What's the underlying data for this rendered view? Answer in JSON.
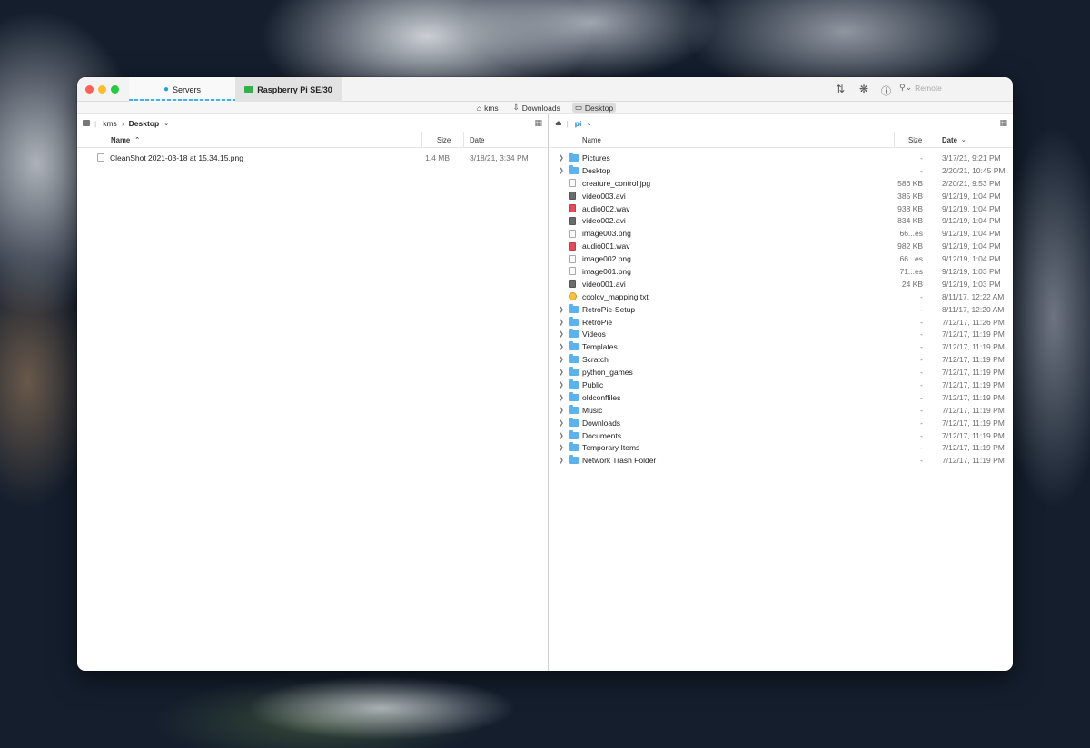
{
  "titlebar": {
    "tabs": [
      {
        "label": "Servers",
        "icon": "globe-icon",
        "active": true
      },
      {
        "label": "Raspberry Pi SE/30",
        "icon": "monitor-icon",
        "active": false
      }
    ],
    "search_placeholder": "Remote",
    "icons": [
      "sort-arrows-icon",
      "sync-icon",
      "info-icon",
      "search-icon"
    ]
  },
  "pathbar": [
    {
      "label": "kms",
      "icon": "home-icon"
    },
    {
      "label": "Downloads",
      "icon": "download-icon"
    },
    {
      "label": "Desktop",
      "icon": "desktop-icon"
    }
  ],
  "left": {
    "path": [
      "kms",
      "Desktop"
    ],
    "columns": {
      "name": "Name",
      "size": "Size",
      "date": "Date"
    },
    "files": [
      {
        "name": "CleanShot 2021-03-18 at 15.34.15.png",
        "size": "1.4 MB",
        "date": "3/18/21, 3:34 PM",
        "type": "image"
      }
    ]
  },
  "right": {
    "path": "pi",
    "columns": {
      "name": "Name",
      "size": "Size",
      "date": "Date"
    },
    "files": [
      {
        "name": "Pictures",
        "size": "-",
        "date": "3/17/21, 9:21 PM",
        "type": "folder"
      },
      {
        "name": "Desktop",
        "size": "-",
        "date": "2/20/21, 10:45 PM",
        "type": "folder"
      },
      {
        "name": "creature_control.jpg",
        "size": "586 KB",
        "date": "2/20/21, 9:53 PM",
        "type": "image"
      },
      {
        "name": "video003.avi",
        "size": "385 KB",
        "date": "9/12/19, 1:04 PM",
        "type": "video"
      },
      {
        "name": "audio002.wav",
        "size": "938 KB",
        "date": "9/12/19, 1:04 PM",
        "type": "audio"
      },
      {
        "name": "video002.avi",
        "size": "834 KB",
        "date": "9/12/19, 1:04 PM",
        "type": "video"
      },
      {
        "name": "image003.png",
        "size": "66...es",
        "date": "9/12/19, 1:04 PM",
        "type": "image"
      },
      {
        "name": "audio001.wav",
        "size": "982 KB",
        "date": "9/12/19, 1:04 PM",
        "type": "audio"
      },
      {
        "name": "image002.png",
        "size": "66...es",
        "date": "9/12/19, 1:04 PM",
        "type": "image"
      },
      {
        "name": "image001.png",
        "size": "71...es",
        "date": "9/12/19, 1:03 PM",
        "type": "image"
      },
      {
        "name": "video001.avi",
        "size": "24 KB",
        "date": "9/12/19, 1:03 PM",
        "type": "video"
      },
      {
        "name": "coolcv_mapping.txt",
        "size": "-",
        "date": "8/11/17, 12:22 AM",
        "type": "txt"
      },
      {
        "name": "RetroPie-Setup",
        "size": "-",
        "date": "8/11/17, 12:20 AM",
        "type": "folder"
      },
      {
        "name": "RetroPie",
        "size": "-",
        "date": "7/12/17, 11:26 PM",
        "type": "folder"
      },
      {
        "name": "Videos",
        "size": "-",
        "date": "7/12/17, 11:19 PM",
        "type": "folder"
      },
      {
        "name": "Templates",
        "size": "-",
        "date": "7/12/17, 11:19 PM",
        "type": "folder"
      },
      {
        "name": "Scratch",
        "size": "-",
        "date": "7/12/17, 11:19 PM",
        "type": "folder"
      },
      {
        "name": "python_games",
        "size": "-",
        "date": "7/12/17, 11:19 PM",
        "type": "folder"
      },
      {
        "name": "Public",
        "size": "-",
        "date": "7/12/17, 11:19 PM",
        "type": "folder"
      },
      {
        "name": "oldconffiles",
        "size": "-",
        "date": "7/12/17, 11:19 PM",
        "type": "folder"
      },
      {
        "name": "Music",
        "size": "-",
        "date": "7/12/17, 11:19 PM",
        "type": "folder"
      },
      {
        "name": "Downloads",
        "size": "-",
        "date": "7/12/17, 11:19 PM",
        "type": "folder"
      },
      {
        "name": "Documents",
        "size": "-",
        "date": "7/12/17, 11:19 PM",
        "type": "folder"
      },
      {
        "name": "Temporary Items",
        "size": "-",
        "date": "7/12/17, 11:19 PM",
        "type": "folder"
      },
      {
        "name": "Network Trash Folder",
        "size": "-",
        "date": "7/12/17, 11:19 PM",
        "type": "folder"
      }
    ]
  }
}
